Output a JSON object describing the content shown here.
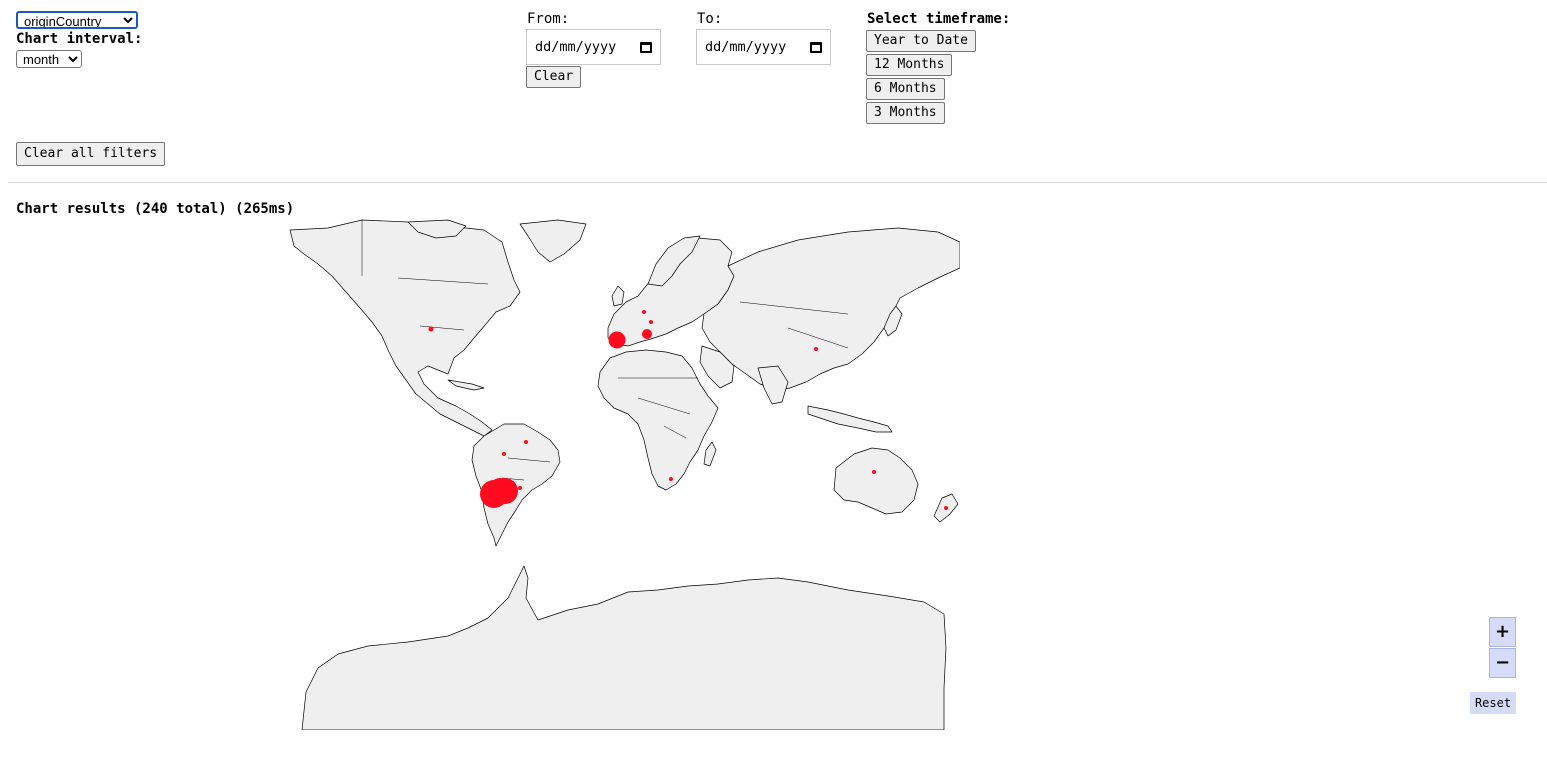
{
  "filters": {
    "dimension": {
      "selected": "originCountry"
    },
    "interval_label": "Chart interval:",
    "interval": {
      "selected": "month"
    },
    "from_label": "From:",
    "to_label": "To:",
    "from_value": "dd/mm/yyyy",
    "to_value": "dd/mm/yyyy",
    "clear_label": "Clear",
    "timeframe_label": "Select timeframe:",
    "timeframes": [
      "Year to Date",
      "12 Months",
      "6 Months",
      "3 Months"
    ],
    "clear_all_label": "Clear all filters"
  },
  "results": {
    "summary": "Chart results (240 total) (265ms)"
  },
  "map": {
    "land_color": "#efefef",
    "marker_color": "#ff0a1e",
    "zoom_in": "+",
    "zoom_out": "−",
    "reset": "Reset"
  }
}
